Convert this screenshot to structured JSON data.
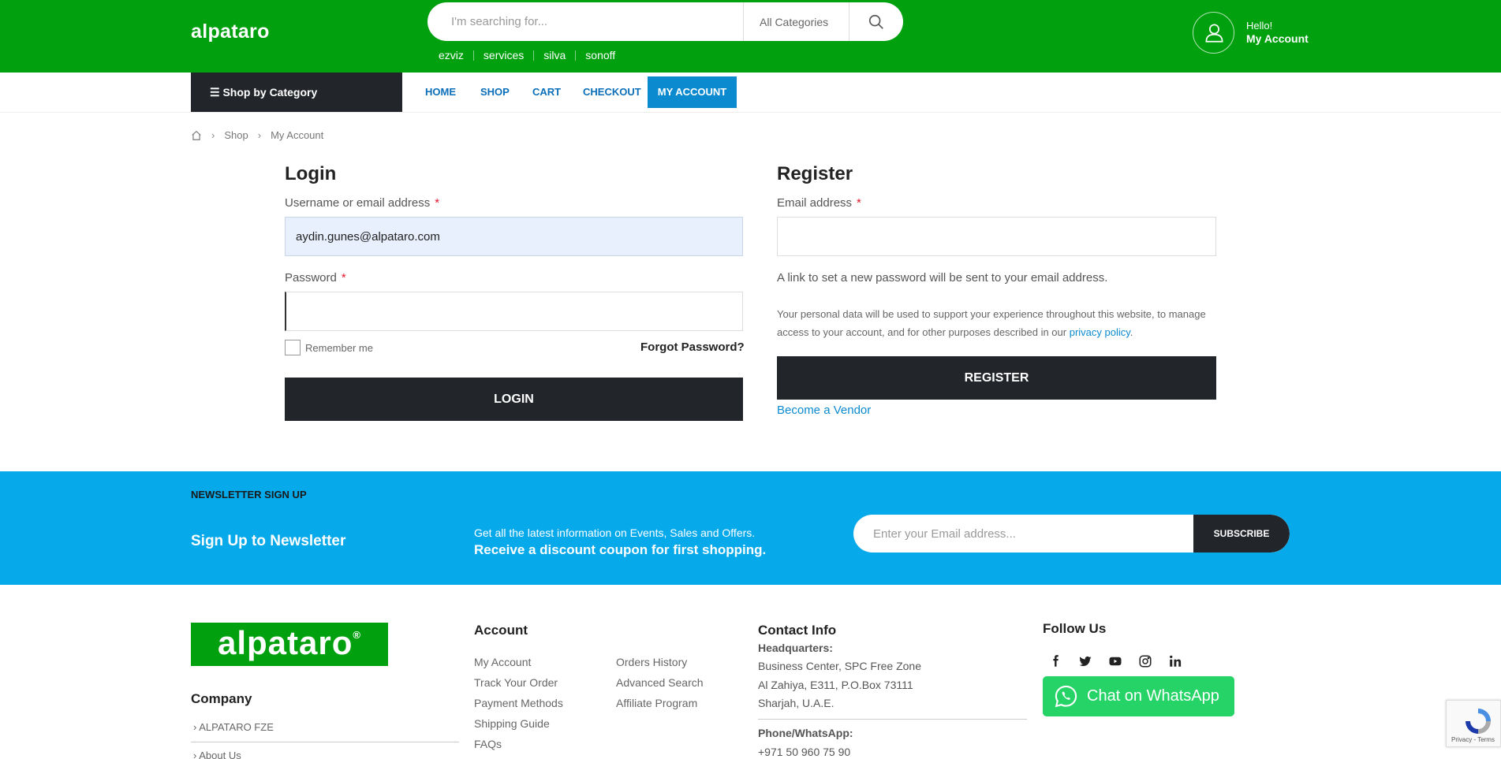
{
  "header": {
    "logo": "alpataro",
    "search_placeholder": "I'm searching for...",
    "search_category": "All Categories",
    "tags": [
      "ezviz",
      "services",
      "silva",
      "sonoff"
    ],
    "hello": "Hello!",
    "my_account": "My Account"
  },
  "nav": {
    "shop_by_category": "Shop by Category",
    "links": [
      "HOME",
      "SHOP",
      "CART",
      "CHECKOUT"
    ],
    "active": "MY ACCOUNT"
  },
  "breadcrumb": [
    "Shop",
    "My Account"
  ],
  "login": {
    "title": "Login",
    "username_label": "Username or email address",
    "username_value": "aydin.gunes@alpataro.com",
    "password_label": "Password",
    "required_mark": "*",
    "remember": "Remember me",
    "forgot": "Forgot Password?",
    "button": "LOGIN"
  },
  "register": {
    "title": "Register",
    "email_label": "Email address",
    "info": "A link to set a new password will be sent to your email address.",
    "privacy_text": "Your personal data will be used to support your experience throughout this website, to manage access to your account, and for other purposes described in our ",
    "privacy_link": "privacy policy",
    "privacy_end": ".",
    "button": "REGISTER",
    "vendor": "Become a Vendor"
  },
  "newsletter": {
    "heading": "NEWSLETTER SIGN UP",
    "title": "Sign Up to Newsletter",
    "info1": "Get all the latest information on Events, Sales and Offers.",
    "info2": "Receive a discount coupon for first shopping.",
    "placeholder": "Enter your Email address...",
    "button": "SUBSCRIBE"
  },
  "footer": {
    "logo": "alpataro",
    "logo_mark": "®",
    "company": {
      "title": "Company",
      "links": [
        "ALPATARO FZE",
        "About Us"
      ]
    },
    "account": {
      "title": "Account",
      "col1": [
        "My Account",
        "Track Your Order",
        "Payment Methods",
        "Shipping Guide",
        "FAQs"
      ],
      "col2": [
        "Orders History",
        "Advanced Search",
        "Affiliate Program"
      ]
    },
    "contact": {
      "title": "Contact Info",
      "hq_label": "Headquarters:",
      "hq_lines": [
        "Business Center, SPC Free Zone",
        "Al Zahiya, E311, P.O.Box 73111",
        "Sharjah, U.A.E."
      ],
      "phone_label": "Phone/WhatsApp:",
      "phone": "+971 50 960 75 90"
    },
    "follow": {
      "title": "Follow Us",
      "icons": [
        "facebook-icon",
        "twitter-icon",
        "youtube-icon",
        "instagram-icon",
        "linkedin-icon"
      ],
      "whatsapp": "Chat on WhatsApp"
    },
    "recaptcha": "Privacy - Terms"
  },
  "colors": {
    "brand_green": "#00a00e",
    "newsletter_blue": "#06a9ea",
    "dark": "#22252a",
    "link_blue": "#0b8ad0",
    "whatsapp_green": "#25d366"
  }
}
